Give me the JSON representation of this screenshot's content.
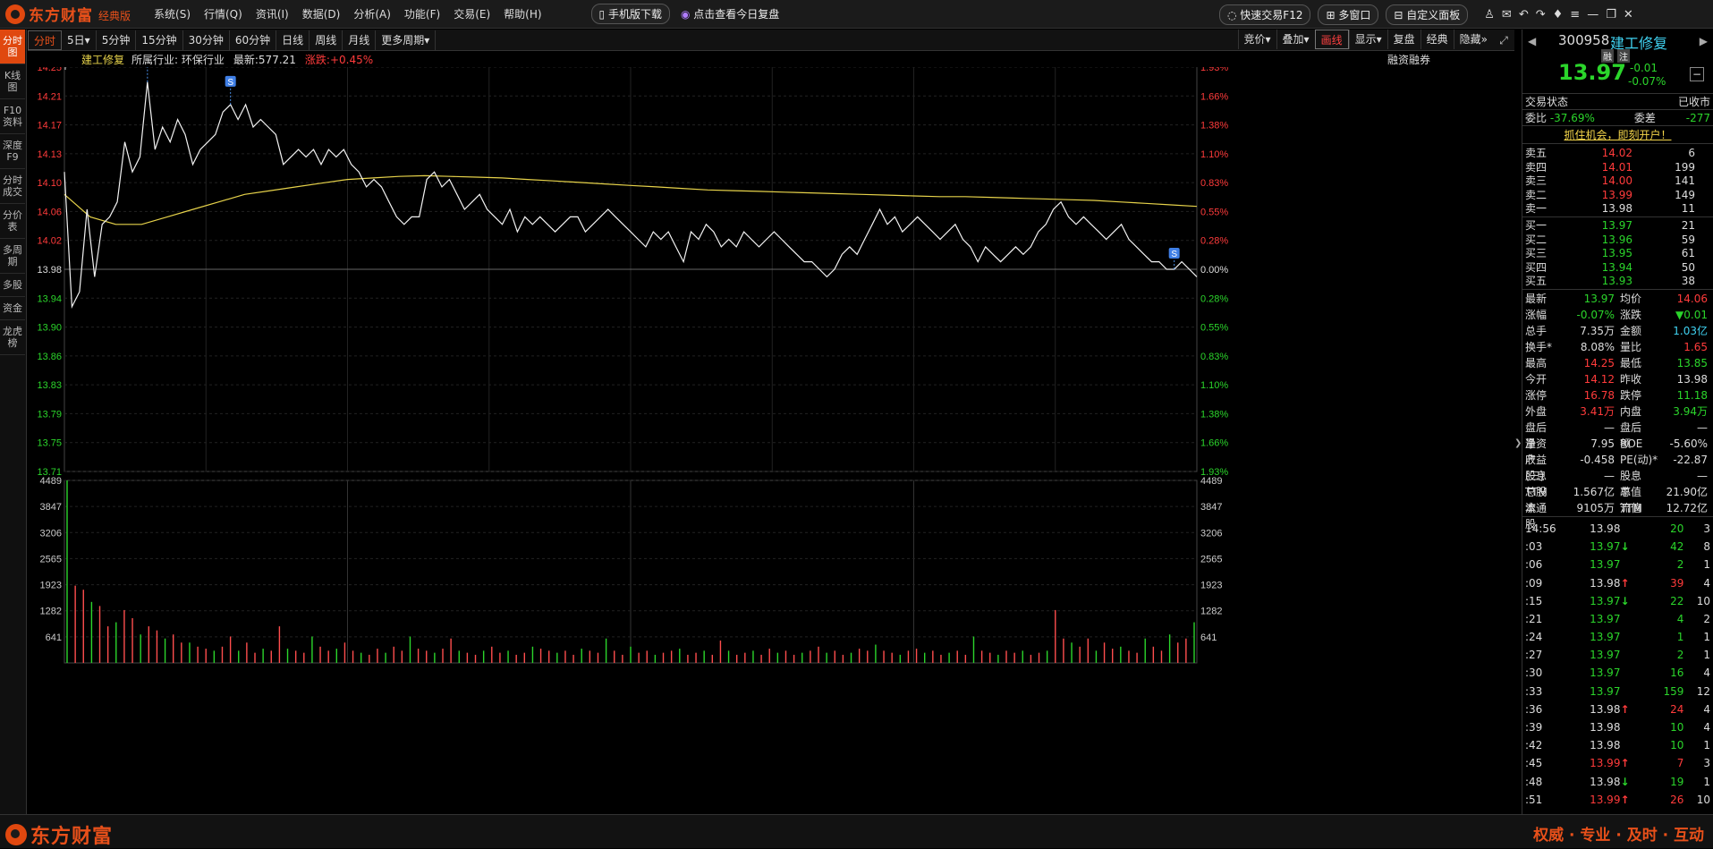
{
  "app": {
    "logo_text": "东方财富",
    "edition": "经典版"
  },
  "menu": [
    "系统(S)",
    "行情(Q)",
    "资讯(I)",
    "数据(D)",
    "分析(A)",
    "功能(F)",
    "交易(E)",
    "帮助(H)"
  ],
  "top": {
    "mobile_download": "手机版下载",
    "review_link": "点击查看今日复盘",
    "quick_trade": "快速交易F12",
    "multi_window": "多窗口",
    "custom_panel": "自定义面板"
  },
  "left_tabs": [
    "分时图",
    "K线图",
    "F10资料",
    "深度F9",
    "分时成交",
    "分价表",
    "多周期",
    "多股",
    "资金",
    "龙虎榜"
  ],
  "period_tabs": [
    "分时",
    "5日▾",
    "5分钟",
    "15分钟",
    "30分钟",
    "60分钟",
    "日线",
    "周线",
    "月线",
    "更多周期▾"
  ],
  "tools": [
    "竞价▾",
    "叠加▾",
    "画线",
    "显示▾",
    "复盘",
    "经典",
    "隐藏»"
  ],
  "info": {
    "name": "建工修复",
    "industry": "所属行业: 环保行业",
    "latest": "最新:577.21",
    "change": "涨跌:+0.45%",
    "margin": "融资融券"
  },
  "chart_data": {
    "type": "line",
    "title": "建工修复",
    "xlabel": "",
    "ylabel": "",
    "ylim": [
      13.71,
      14.25
    ],
    "prev_close": 13.98,
    "price_ticks": [
      "14.25",
      "14.21",
      "14.17",
      "14.13",
      "14.10",
      "14.06",
      "14.02",
      "13.98",
      "13.94",
      "13.90",
      "13.86",
      "13.83",
      "13.79",
      "13.75",
      "13.71"
    ],
    "pct_ticks": [
      "1.93%",
      "1.66%",
      "1.38%",
      "1.10%",
      "0.83%",
      "0.55%",
      "0.28%",
      "0.00%",
      "0.28%",
      "0.55%",
      "0.83%",
      "1.10%",
      "1.38%",
      "1.66%",
      "1.93%"
    ],
    "volume_ticks": [
      "4489",
      "3847",
      "3206",
      "2565",
      "1923",
      "1282",
      "641"
    ],
    "price_points": [
      14.11,
      13.93,
      13.95,
      14.06,
      13.97,
      14.04,
      14.05,
      14.07,
      14.15,
      14.11,
      14.13,
      14.23,
      14.14,
      14.17,
      14.15,
      14.18,
      14.16,
      14.12,
      14.14,
      14.15,
      14.16,
      14.19,
      14.2,
      14.18,
      14.2,
      14.17,
      14.18,
      14.17,
      14.16,
      14.12,
      14.13,
      14.14,
      14.13,
      14.14,
      14.12,
      14.14,
      14.13,
      14.14,
      14.12,
      14.11,
      14.09,
      14.1,
      14.09,
      14.07,
      14.05,
      14.04,
      14.05,
      14.05,
      14.1,
      14.11,
      14.09,
      14.1,
      14.08,
      14.06,
      14.07,
      14.08,
      14.06,
      14.05,
      14.04,
      14.06,
      14.03,
      14.05,
      14.04,
      14.05,
      14.04,
      14.03,
      14.04,
      14.05,
      14.05,
      14.03,
      14.04,
      14.05,
      14.06,
      14.05,
      14.04,
      14.03,
      14.02,
      14.01,
      14.03,
      14.02,
      14.03,
      14.01,
      13.99,
      14.03,
      14.02,
      14.04,
      14.03,
      14.01,
      14.02,
      14.01,
      14.03,
      14.02,
      14.01,
      14.02,
      14.03,
      14.02,
      14.01,
      14.0,
      13.99,
      13.99,
      13.98,
      13.97,
      13.98,
      14.0,
      14.01,
      14.0,
      14.02,
      14.04,
      14.06,
      14.04,
      14.05,
      14.03,
      14.04,
      14.05,
      14.04,
      14.03,
      14.02,
      14.03,
      14.04,
      14.02,
      14.01,
      13.99,
      14.01,
      14.0,
      13.99,
      14.0,
      14.01,
      14.0,
      14.01,
      14.03,
      14.04,
      14.06,
      14.07,
      14.05,
      14.04,
      14.05,
      14.04,
      14.03,
      14.02,
      14.03,
      14.04,
      14.02,
      14.01,
      14.0,
      13.99,
      13.99,
      13.98,
      13.98,
      13.99,
      13.98,
      13.97
    ],
    "avg_points": [
      14.08,
      14.05,
      14.04,
      14.04,
      14.05,
      14.06,
      14.07,
      14.08,
      14.085,
      14.09,
      14.095,
      14.1,
      14.102,
      14.104,
      14.105,
      14.104,
      14.103,
      14.102,
      14.1,
      14.098,
      14.096,
      14.094,
      14.092,
      14.09,
      14.088,
      14.086,
      14.085,
      14.084,
      14.083,
      14.082,
      14.081,
      14.08,
      14.079,
      14.078,
      14.077,
      14.077,
      14.076,
      14.075,
      14.074,
      14.073,
      14.072,
      14.07,
      14.068,
      14.066,
      14.064
    ],
    "volume_points": [
      4489,
      1900,
      1800,
      1500,
      1400,
      900,
      1000,
      1300,
      1100,
      700,
      900,
      800,
      600,
      700,
      500,
      500,
      400,
      350,
      300,
      400,
      650,
      300,
      500,
      250,
      350,
      300,
      900,
      350,
      300,
      250,
      650,
      400,
      300,
      350,
      500,
      300,
      250,
      200,
      350,
      250,
      400,
      300,
      650,
      350,
      300,
      250,
      350,
      600,
      300,
      250,
      200,
      300,
      400,
      250,
      300,
      200,
      250,
      400,
      350,
      300,
      250,
      300,
      200,
      350,
      300,
      250,
      600,
      300,
      200,
      400,
      250,
      300,
      200,
      250,
      300,
      350,
      200,
      250,
      300,
      200,
      550,
      300,
      200,
      250,
      300,
      200,
      350,
      250,
      300,
      200,
      250,
      300,
      400,
      250,
      300,
      200,
      250,
      350,
      300,
      450,
      300,
      250,
      200,
      300,
      350,
      250,
      300,
      200,
      250,
      300,
      200,
      650,
      300,
      250,
      200,
      300,
      250,
      300,
      200,
      250,
      300,
      1300,
      600,
      500,
      400,
      600,
      300,
      500,
      350,
      400,
      300,
      250,
      600,
      400,
      300,
      700,
      500,
      600,
      1000
    ],
    "trade_markers": [
      {
        "label": "S",
        "index": 11
      },
      {
        "label": "S",
        "index": 22
      },
      {
        "label": "S",
        "index": 147
      }
    ]
  },
  "quote": {
    "code": "300958",
    "name": "建工修复",
    "badge1": "融",
    "badge2": "注",
    "price": "13.97",
    "chg": "-0.01",
    "chg_pct": "-0.07%"
  },
  "status": {
    "label": "交易状态",
    "value": "已收市"
  },
  "ratio": {
    "wb_label": "委比",
    "wb_value": "-37.69%",
    "wc_label": "委差",
    "wc_value": "-277"
  },
  "promo": "抓住机会，即刻开户！",
  "asks": [
    {
      "label": "卖五",
      "price": "14.02",
      "vol": "6"
    },
    {
      "label": "卖四",
      "price": "14.01",
      "vol": "199"
    },
    {
      "label": "卖三",
      "price": "14.00",
      "vol": "141"
    },
    {
      "label": "卖二",
      "price": "13.99",
      "vol": "149"
    },
    {
      "label": "卖一",
      "price": "13.98",
      "vol": "11"
    }
  ],
  "bids": [
    {
      "label": "买一",
      "price": "13.97",
      "vol": "21"
    },
    {
      "label": "买二",
      "price": "13.96",
      "vol": "59"
    },
    {
      "label": "买三",
      "price": "13.95",
      "vol": "61"
    },
    {
      "label": "买四",
      "price": "13.94",
      "vol": "50"
    },
    {
      "label": "买五",
      "price": "13.93",
      "vol": "38"
    }
  ],
  "stats": [
    {
      "k": "最新",
      "v": "13.97",
      "vc": "g",
      "k2": "均价",
      "v2": "14.06",
      "v2c": "r"
    },
    {
      "k": "涨幅",
      "v": "-0.07%",
      "vc": "g",
      "k2": "涨跌",
      "v2": "▼0.01",
      "v2c": "g"
    },
    {
      "k": "总手",
      "v": "7.35万",
      "vc": "w",
      "k2": "金额",
      "v2": "1.03亿",
      "v2c": "c"
    },
    {
      "k": "换手*",
      "v": "8.08%",
      "vc": "w",
      "k2": "量比",
      "v2": "1.65",
      "v2c": "r"
    },
    {
      "k": "最高",
      "v": "14.25",
      "vc": "r",
      "k2": "最低",
      "v2": "13.85",
      "v2c": "g"
    },
    {
      "k": "今开",
      "v": "14.12",
      "vc": "r",
      "k2": "昨收",
      "v2": "13.98",
      "v2c": "w"
    },
    {
      "k": "涨停",
      "v": "16.78",
      "vc": "r",
      "k2": "跌停",
      "v2": "11.18",
      "v2c": "g"
    },
    {
      "k": "外盘",
      "v": "3.41万",
      "vc": "r",
      "k2": "内盘",
      "v2": "3.94万",
      "v2c": "g"
    },
    {
      "k": "盘后量",
      "v": "—",
      "vc": "w",
      "k2": "盘后额",
      "v2": "—",
      "v2c": "w"
    },
    {
      "k": "净资产",
      "v": "7.95",
      "vc": "w",
      "k2": "ROE",
      "v2": "-5.60%",
      "v2c": "w"
    },
    {
      "k": "收益(三)",
      "v": "-0.458",
      "vc": "w",
      "k2": "PE(动)*",
      "v2": "-22.87",
      "v2c": "w"
    },
    {
      "k": "股息TTM",
      "v": "—",
      "vc": "w",
      "k2": "股息率TTM",
      "v2": "—",
      "v2c": "w"
    },
    {
      "k": "总股本",
      "v": "1.567亿",
      "vc": "w",
      "k2": "总值",
      "v2": "21.90亿",
      "v2c": "w"
    },
    {
      "k": "流通股",
      "v": "9105万",
      "vc": "w",
      "k2": "流值",
      "v2": "12.72亿",
      "v2c": "w"
    }
  ],
  "ticks": [
    {
      "t": "14:56",
      "p": "13.98",
      "pc": "w",
      "a": "",
      "ac": "w",
      "v": "20",
      "vc": "g",
      "n": "3"
    },
    {
      "t": ":03",
      "p": "13.97",
      "pc": "g",
      "a": "↓",
      "ac": "g",
      "v": "42",
      "vc": "g",
      "n": "8"
    },
    {
      "t": ":06",
      "p": "13.97",
      "pc": "g",
      "a": "",
      "ac": "w",
      "v": "2",
      "vc": "g",
      "n": "1"
    },
    {
      "t": ":09",
      "p": "13.98",
      "pc": "w",
      "a": "↑",
      "ac": "r",
      "v": "39",
      "vc": "r",
      "n": "4"
    },
    {
      "t": ":15",
      "p": "13.97",
      "pc": "g",
      "a": "↓",
      "ac": "g",
      "v": "22",
      "vc": "g",
      "n": "10"
    },
    {
      "t": ":21",
      "p": "13.97",
      "pc": "g",
      "a": "",
      "ac": "w",
      "v": "4",
      "vc": "g",
      "n": "2"
    },
    {
      "t": ":24",
      "p": "13.97",
      "pc": "g",
      "a": "",
      "ac": "w",
      "v": "1",
      "vc": "g",
      "n": "1"
    },
    {
      "t": ":27",
      "p": "13.97",
      "pc": "g",
      "a": "",
      "ac": "w",
      "v": "2",
      "vc": "g",
      "n": "1"
    },
    {
      "t": ":30",
      "p": "13.97",
      "pc": "g",
      "a": "",
      "ac": "w",
      "v": "16",
      "vc": "g",
      "n": "4"
    },
    {
      "t": ":33",
      "p": "13.97",
      "pc": "g",
      "a": "",
      "ac": "w",
      "v": "159",
      "vc": "g",
      "n": "12"
    },
    {
      "t": ":36",
      "p": "13.98",
      "pc": "w",
      "a": "↑",
      "ac": "r",
      "v": "24",
      "vc": "r",
      "n": "4"
    },
    {
      "t": ":39",
      "p": "13.98",
      "pc": "w",
      "a": "",
      "ac": "w",
      "v": "10",
      "vc": "g",
      "n": "4"
    },
    {
      "t": ":42",
      "p": "13.98",
      "pc": "w",
      "a": "",
      "ac": "w",
      "v": "10",
      "vc": "g",
      "n": "1"
    },
    {
      "t": ":45",
      "p": "13.99",
      "pc": "r",
      "a": "↑",
      "ac": "r",
      "v": "7",
      "vc": "r",
      "n": "3"
    },
    {
      "t": ":48",
      "p": "13.98",
      "pc": "w",
      "a": "↓",
      "ac": "g",
      "v": "19",
      "vc": "g",
      "n": "1"
    },
    {
      "t": ":51",
      "p": "13.99",
      "pc": "r",
      "a": "↑",
      "ac": "r",
      "v": "26",
      "vc": "r",
      "n": "10"
    }
  ],
  "bottom": {
    "logo_text": "东方财富",
    "slogan": "权威 · 专业 · 及时 · 互动"
  }
}
